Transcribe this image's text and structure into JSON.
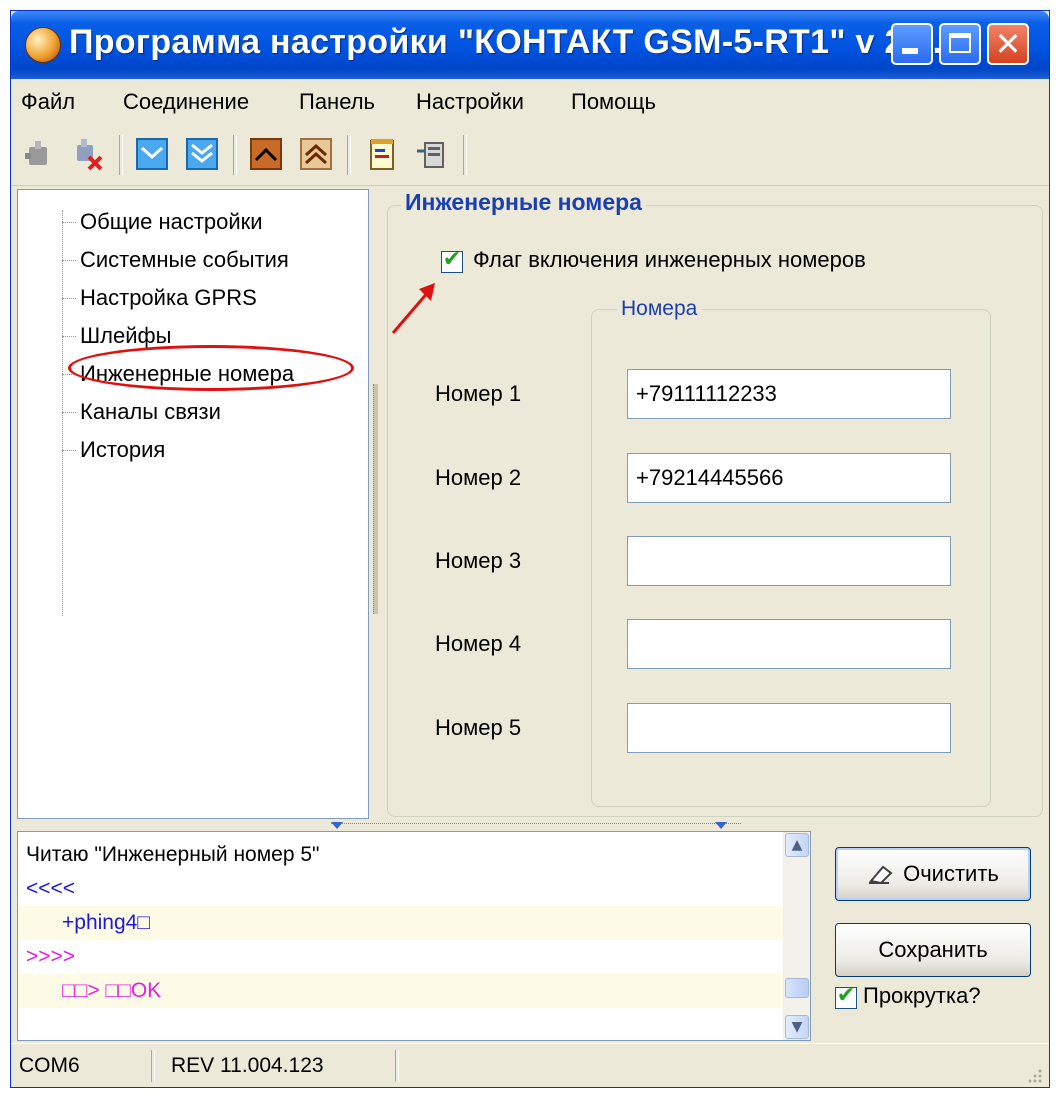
{
  "window": {
    "title": "Программа настройки \"КОНТАКТ GSM-5-RT1\" v 2.0...",
    "close_glyph": "✕"
  },
  "menu": {
    "items": [
      "Файл",
      "Соединение",
      "Панель",
      "Настройки",
      "Помощь"
    ]
  },
  "toolbar": {
    "icons": [
      "connect-icon",
      "disconnect-icon",
      "read-icon",
      "read-all-icon",
      "write-icon",
      "write-all-icon",
      "notepad-icon",
      "export-icon"
    ]
  },
  "tree": {
    "items": [
      {
        "label": "Общие настройки"
      },
      {
        "label": "Системные события"
      },
      {
        "label": "Настройка GPRS"
      },
      {
        "label": "Шлейфы"
      },
      {
        "label": "Инженерные номера"
      },
      {
        "label": "Каналы связи"
      },
      {
        "label": "История"
      }
    ],
    "selected_index": 4
  },
  "engineer_numbers": {
    "title": "Инженерные номера",
    "enable_flag": {
      "label": "Флаг включения инженерных номеров",
      "checked": true,
      "glyph": "✔"
    },
    "numbers_group_title": "Номера",
    "numbers": [
      {
        "label": "Номер 1",
        "value": "+79111112233"
      },
      {
        "label": "Номер 2",
        "value": "+79214445566"
      },
      {
        "label": "Номер 3",
        "value": ""
      },
      {
        "label": "Номер 4",
        "value": ""
      },
      {
        "label": "Номер 5",
        "value": ""
      }
    ]
  },
  "log": {
    "lines": [
      {
        "text": "Читаю \"Инженерный номер 5\"",
        "color": "#000000",
        "indent": false
      },
      {
        "text": "<<<<",
        "color": "#1a1adc",
        "indent": false
      },
      {
        "text": "+phing4□",
        "color": "#1a1adc",
        "indent": true
      },
      {
        "text": ">>>>",
        "color": "#e020e0",
        "indent": false
      },
      {
        "text": "□□> □□OK",
        "color": "#e020e0",
        "indent": true
      }
    ],
    "scroll_up": "▲",
    "scroll_down": "▼"
  },
  "buttons": {
    "clear_label": "Очистить",
    "save_label": "Сохранить",
    "scroll_checkbox": {
      "label": "Прокрутка?",
      "checked": true,
      "glyph": "✔"
    }
  },
  "status": {
    "port": "COM6",
    "revision": "REV 11.004.123"
  },
  "colors": {
    "title_bar": "#0053e1",
    "group_title": "#1a3fb5",
    "annotation_red": "#e01010"
  }
}
